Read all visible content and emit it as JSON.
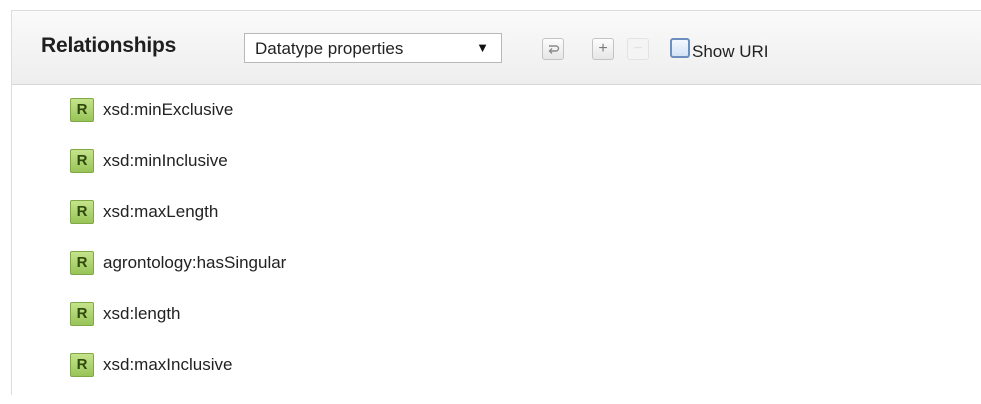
{
  "panel": {
    "title": "Relationships",
    "property_select": {
      "selected": "Datatype properties",
      "arrow": "▼"
    },
    "toolbar": {
      "refresh_icon": "refresh-icon",
      "add_symbol": "+",
      "remove_symbol": "−",
      "show_uri_label": "Show URI",
      "show_uri_checked": false
    }
  },
  "relationships": [
    {
      "badge": "R",
      "label": "xsd:minExclusive"
    },
    {
      "badge": "R",
      "label": "xsd:minInclusive"
    },
    {
      "badge": "R",
      "label": "xsd:maxLength"
    },
    {
      "badge": "R",
      "label": "agrontology:hasSingular"
    },
    {
      "badge": "R",
      "label": "xsd:length"
    },
    {
      "badge": "R",
      "label": "xsd:maxInclusive"
    }
  ],
  "colors": {
    "badge_green": "#a6cf66",
    "checkbox_blue": "#6c8fc1",
    "header_bg": "#efefef"
  }
}
